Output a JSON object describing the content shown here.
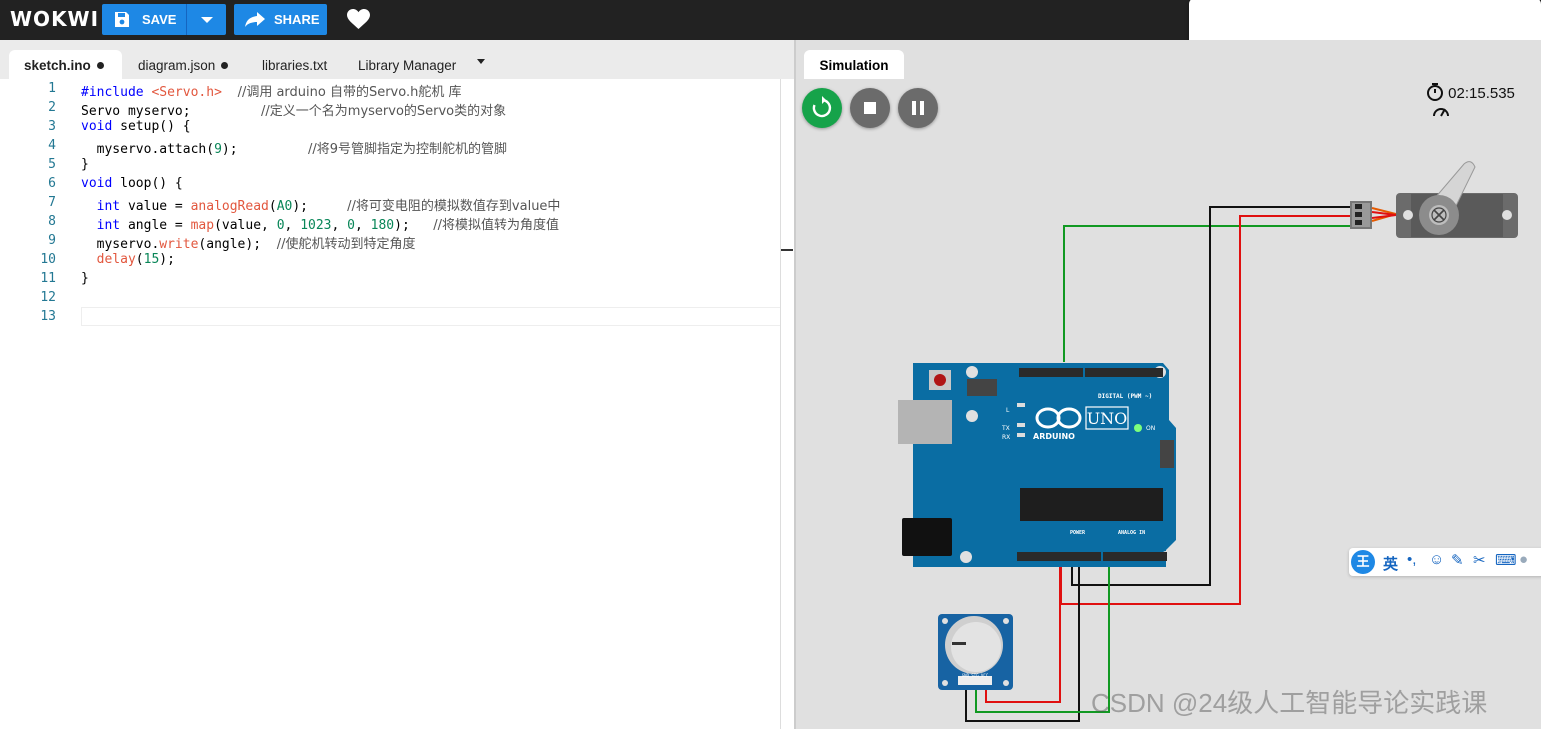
{
  "app": {
    "logo": "WOKWI",
    "save_label": "SAVE",
    "share_label": "SHARE"
  },
  "tabs": [
    {
      "label": "sketch.ino",
      "modified": true,
      "active": true
    },
    {
      "label": "diagram.json",
      "modified": true,
      "active": false
    },
    {
      "label": "libraries.txt",
      "modified": false,
      "active": false
    },
    {
      "label": "Library Manager",
      "modified": false,
      "active": false
    }
  ],
  "editor": {
    "line_numbers": [
      "1",
      "2",
      "3",
      "4",
      "5",
      "6",
      "7",
      "8",
      "9",
      "10",
      "11",
      "12",
      "13"
    ],
    "lines": [
      "#include <Servo.h>  //调用 arduino 自带的Servo.h舵机 库",
      "Servo myservo;         //定义一个名为myservo的Servo类的对象",
      "void setup() {",
      "  myservo.attach(9);         //将9号管脚指定为控制舵机的管脚",
      "}",
      "void loop() {",
      "  int value = analogRead(A0);     //将可变电阻的模拟数值存到value中",
      "  int angle = map(value, 0, 1023, 0, 180);   //将模拟值转为角度值",
      "  myservo.write(angle);  //使舵机转动到特定角度",
      "  delay(15);",
      "}",
      "",
      ""
    ]
  },
  "simulation": {
    "tab_label": "Simulation",
    "timer": "02:15.535",
    "board": {
      "logo_text": "ARDUINO",
      "model": "UNO",
      "digital_label": "DIGITAL (PWM ~)",
      "power_label": "POWER",
      "analog_label": "ANALOG IN",
      "on_label": "ON",
      "l_label": "L",
      "tx_label": "TX",
      "rx_label": "RX"
    },
    "pot_labels": "GND SIG VCC",
    "wire_colors": {
      "signal": "#119922",
      "power": "#e01010",
      "ground": "#111111"
    }
  },
  "ime": {
    "lang": "英",
    "brand": "王"
  },
  "watermark": "CSDN @24级人工智能导论实践课"
}
